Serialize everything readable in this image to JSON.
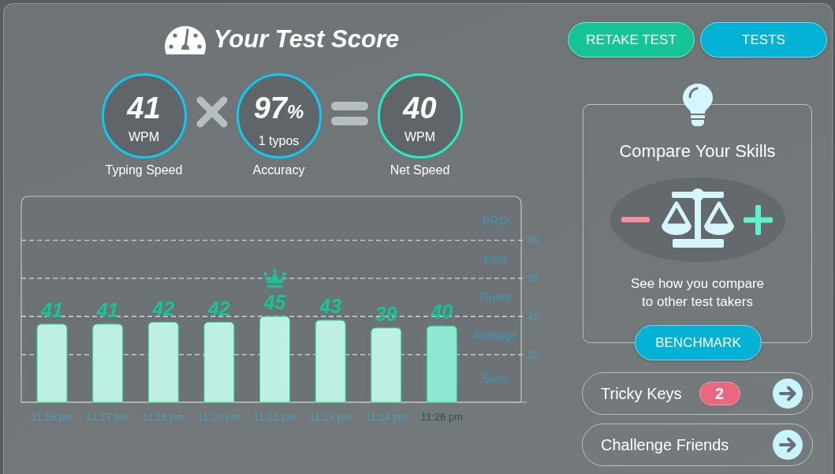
{
  "header": {
    "title": "Your Test Score"
  },
  "metrics": [
    {
      "value": "41",
      "unit": "WPM",
      "label": "Typing Speed",
      "color": "#0ccaf0"
    },
    {
      "value": "97",
      "suffix": "%",
      "unit": "1 typos",
      "label": "Accuracy",
      "color": "#0ccaf0"
    },
    {
      "value": "40",
      "unit": "WPM",
      "label": "Net Speed",
      "color": "#20eec0"
    }
  ],
  "chart": {
    "speed_levels": [
      "PRO",
      "Fast",
      "Fluent",
      "Average",
      "Slow"
    ],
    "bars": [
      {
        "selected": false,
        "crowned": false
      },
      {
        "selected": false,
        "crowned": false
      },
      {
        "selected": false,
        "crowned": false
      },
      {
        "selected": false,
        "crowned": false
      },
      {
        "selected": false,
        "crowned": true
      },
      {
        "selected": false,
        "crowned": false
      },
      {
        "selected": false,
        "crowned": false
      },
      {
        "selected": true,
        "crowned": false
      }
    ],
    "chart_data": {
      "type": "bar",
      "categories": [
        "11:16 pm",
        "11:17 pm",
        "11:18 pm",
        "11:20 pm",
        "11:21 pm",
        "11:23 pm",
        "11:24 pm",
        "11:26 pm"
      ],
      "values": [
        41,
        41,
        42,
        42,
        45,
        43,
        39,
        40
      ],
      "ylim": [
        0,
        108
      ],
      "yticks": [
        25,
        45,
        65,
        85
      ],
      "grid": true,
      "data_labels": true
    }
  },
  "buttons": [
    {
      "label": "RETAKE TEST",
      "kind": "retake"
    },
    {
      "label": "TESTS",
      "kind": "tests"
    }
  ],
  "compare": {
    "title": "Compare Your Skills",
    "text": "See how you compare to other test takers",
    "button": "BENCHMARK"
  },
  "links": [
    {
      "label": "Tricky Keys",
      "badge": "2"
    },
    {
      "label": "Challenge Friends"
    }
  ]
}
